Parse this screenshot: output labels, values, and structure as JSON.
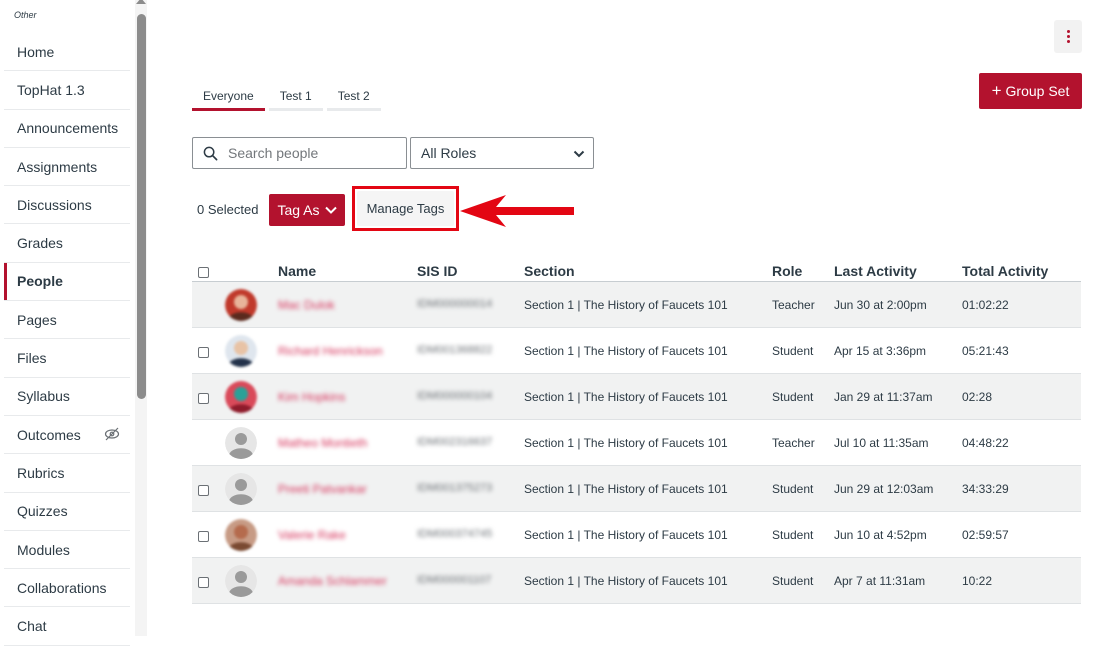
{
  "sidebar": {
    "section_label": "Other",
    "items": [
      {
        "label": "Home"
      },
      {
        "label": "TopHat 1.3"
      },
      {
        "label": "Announcements"
      },
      {
        "label": "Assignments"
      },
      {
        "label": "Discussions"
      },
      {
        "label": "Grades"
      },
      {
        "label": "People",
        "active": true
      },
      {
        "label": "Pages"
      },
      {
        "label": "Files"
      },
      {
        "label": "Syllabus"
      },
      {
        "label": "Outcomes",
        "icon": "eye-slash-icon"
      },
      {
        "label": "Rubrics"
      },
      {
        "label": "Quizzes"
      },
      {
        "label": "Modules"
      },
      {
        "label": "Collaborations"
      },
      {
        "label": "Chat"
      }
    ]
  },
  "header": {
    "group_set_label": "Group Set"
  },
  "tabs": [
    {
      "label": "Everyone",
      "active": true
    },
    {
      "label": "Test 1"
    },
    {
      "label": "Test 2"
    }
  ],
  "filters": {
    "search_placeholder": "Search people",
    "role_selected": "All Roles"
  },
  "actions": {
    "selected_count": "0 Selected",
    "tag_as_label": "Tag As",
    "manage_tags_label": "Manage Tags"
  },
  "table": {
    "columns": [
      "Name",
      "SIS ID",
      "Section",
      "Role",
      "Last Activity",
      "Total Activity"
    ],
    "rows": [
      {
        "name": "Mac Dulok",
        "sis_id": "IDM000000014",
        "section": "Section 1 | The History of Faucets 101",
        "role": "Teacher",
        "last_activity": "Jun 30 at 2:00pm",
        "total_activity": "01:02:22",
        "checkbox": false,
        "avatar": "photo-red"
      },
      {
        "name": "Richard Henrickson",
        "sis_id": "IDM001368822",
        "section": "Section 1 | The History of Faucets 101",
        "role": "Student",
        "last_activity": "Apr 15 at 3:36pm",
        "total_activity": "05:21:43",
        "checkbox": true,
        "avatar": "photo-suit"
      },
      {
        "name": "Kim Hopkins",
        "sis_id": "IDM000000104",
        "section": "Section 1 | The History of Faucets 101",
        "role": "Student",
        "last_activity": "Jan 29 at 11:37am",
        "total_activity": "02:28",
        "checkbox": true,
        "avatar": "photo-flower"
      },
      {
        "name": "Matheo Montieth",
        "sis_id": "IDM002316637",
        "section": "Section 1 | The History of Faucets 101",
        "role": "Teacher",
        "last_activity": "Jul 10 at 11:35am",
        "total_activity": "04:48:22",
        "checkbox": false,
        "avatar": "default"
      },
      {
        "name": "Preeti Patvankar",
        "sis_id": "IDM001375273",
        "section": "Section 1 | The History of Faucets 101",
        "role": "Student",
        "last_activity": "Jun 29 at 12:03am",
        "total_activity": "34:33:29",
        "checkbox": true,
        "avatar": "default"
      },
      {
        "name": "Valerie Rake",
        "sis_id": "IDM000374745",
        "section": "Section 1 | The History of Faucets 101",
        "role": "Student",
        "last_activity": "Jun 10 at 4:52pm",
        "total_activity": "02:59:57",
        "checkbox": true,
        "avatar": "photo-woman"
      },
      {
        "name": "Amanda Schlammer",
        "sis_id": "IDM000001107",
        "section": "Section 1 | The History of Faucets 101",
        "role": "Student",
        "last_activity": "Apr 7 at 11:31am",
        "total_activity": "10:22",
        "checkbox": true,
        "avatar": "default"
      }
    ]
  },
  "colors": {
    "accent": "#b3122e",
    "highlight": "#e30613",
    "row_shade": "#f1f2f2"
  }
}
